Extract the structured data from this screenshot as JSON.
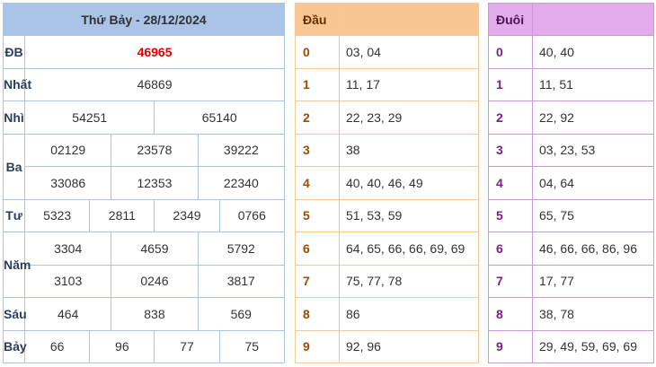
{
  "results": {
    "title": "Thứ Bảy - 28/12/2024",
    "db": {
      "label": "ĐB",
      "value": "46965"
    },
    "nhat": {
      "label": "Nhất",
      "value": "46869"
    },
    "nhi": {
      "label": "Nhì",
      "values": [
        "54251",
        "65140"
      ]
    },
    "ba": {
      "label": "Ba",
      "values": [
        "02129",
        "23578",
        "39222",
        "33086",
        "12353",
        "22340"
      ]
    },
    "tu": {
      "label": "Tư",
      "values": [
        "5323",
        "2811",
        "2349",
        "0766"
      ]
    },
    "nam": {
      "label": "Năm",
      "values": [
        "3304",
        "4659",
        "5792",
        "3103",
        "0246",
        "3817"
      ]
    },
    "sau": {
      "label": "Sáu",
      "values": [
        "464",
        "838",
        "569"
      ]
    },
    "bay": {
      "label": "Bảy",
      "values": [
        "66",
        "96",
        "77",
        "75"
      ]
    }
  },
  "dau": {
    "header": "Đầu",
    "rows": [
      {
        "key": "0",
        "value": "03, 04"
      },
      {
        "key": "1",
        "value": "11, 17"
      },
      {
        "key": "2",
        "value": "22, 23, 29"
      },
      {
        "key": "3",
        "value": "38"
      },
      {
        "key": "4",
        "value": "40, 40, 46, 49"
      },
      {
        "key": "5",
        "value": "51, 53, 59"
      },
      {
        "key": "6",
        "value": "64, 65, 66, 66, 69, 69"
      },
      {
        "key": "7",
        "value": "75, 77, 78"
      },
      {
        "key": "8",
        "value": "86"
      },
      {
        "key": "9",
        "value": "92, 96"
      }
    ]
  },
  "duoi": {
    "header": "Đuôi",
    "rows": [
      {
        "key": "0",
        "value": "40, 40"
      },
      {
        "key": "1",
        "value": "11, 51"
      },
      {
        "key": "2",
        "value": "22, 92"
      },
      {
        "key": "3",
        "value": "03, 23, 53"
      },
      {
        "key": "4",
        "value": "04, 64"
      },
      {
        "key": "5",
        "value": "65, 75"
      },
      {
        "key": "6",
        "value": "46, 66, 66, 86, 96"
      },
      {
        "key": "7",
        "value": "17, 77"
      },
      {
        "key": "8",
        "value": "38, 78"
      },
      {
        "key": "9",
        "value": "29, 49, 59, 69, 69"
      }
    ]
  }
}
